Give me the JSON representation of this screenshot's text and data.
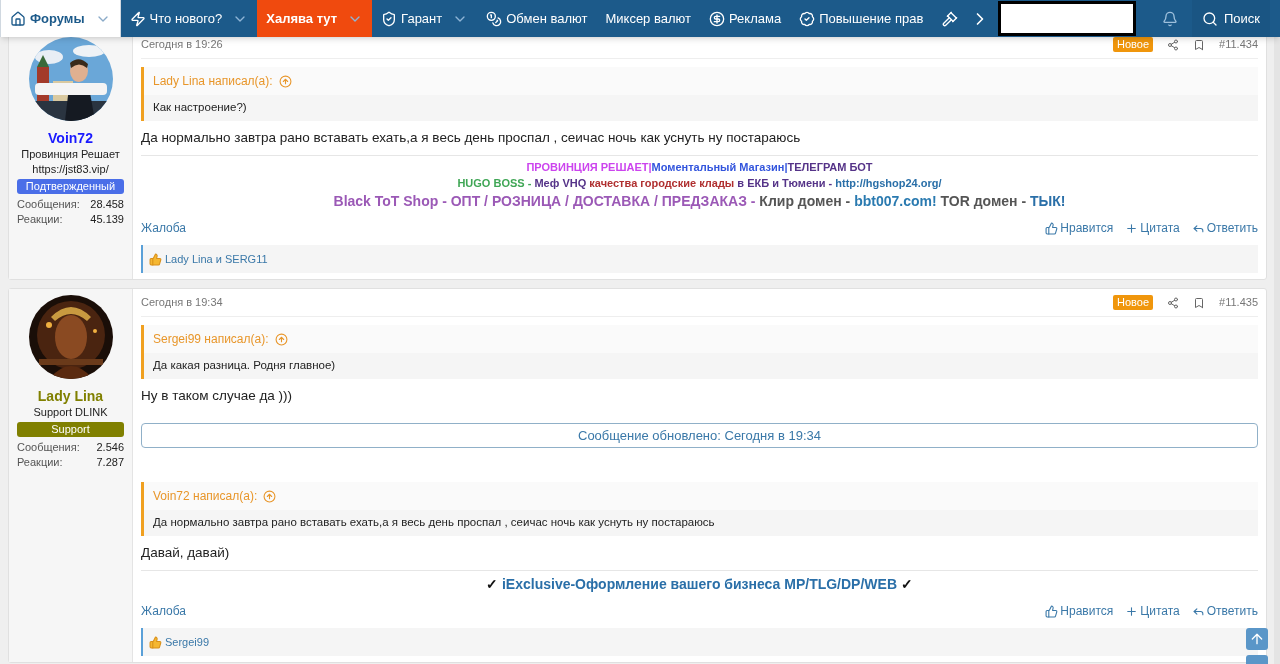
{
  "nav": {
    "items": [
      {
        "label": "Форумы",
        "dropdown": true,
        "selected": true,
        "highlight": false
      },
      {
        "label": "Что нового?",
        "dropdown": true,
        "selected": false,
        "highlight": false
      },
      {
        "label": "Халява тут",
        "dropdown": true,
        "selected": false,
        "highlight": true
      },
      {
        "label": "Гарант",
        "dropdown": true,
        "selected": false,
        "highlight": false
      },
      {
        "label": "Обмен валют",
        "dropdown": false,
        "selected": false,
        "highlight": false
      },
      {
        "label": "Миксер валют",
        "dropdown": false,
        "selected": false,
        "highlight": false
      },
      {
        "label": "Реклама",
        "dropdown": false,
        "selected": false,
        "highlight": false
      },
      {
        "label": "Повышение прав",
        "dropdown": false,
        "selected": false,
        "highlight": false
      }
    ],
    "search": "Поиск"
  },
  "posts": [
    {
      "author": {
        "name": "Voin72",
        "kind": "verified",
        "title": "Провинция Решает",
        "site": "https://jst83.vip/",
        "badge": "Подтвержденный",
        "stats": [
          {
            "label": "Сообщения:",
            "value": "28.458"
          },
          {
            "label": "Реакции:",
            "value": "45.139"
          }
        ]
      },
      "date": "Сегодня в 19:26",
      "new_label": "Новое",
      "is_new": true,
      "number": "#11.434",
      "blocks": [
        {
          "kind": "quote",
          "author": "Lady Lina написал(а):",
          "text": "Как настроение?)"
        },
        {
          "kind": "text",
          "text": "Да нормально завтра рано вставать ехать,а я весь день проспал , сеичас ночь как уснуть ну постараюсь"
        },
        {
          "kind": "signature",
          "lines": [
            {
              "kind": "small",
              "segments": [
                {
                  "text": "ПРОВИНЦИЯ РЕШАЕТ|",
                  "color": "#cc44ee"
                },
                {
                  "text": "Моментальный Магазин|",
                  "color": "#3355dd"
                },
                {
                  "text": "ТЕЛЕГРАМ БОТ",
                  "color": "#553388"
                }
              ]
            },
            {
              "kind": "small",
              "segments": [
                {
                  "text": "HUGO BOSS - ",
                  "color": "#3fa655"
                },
                {
                  "text": "Меф VHQ ",
                  "color": "#553388"
                },
                {
                  "text": "качества городские клады ",
                  "color": "#b03030"
                },
                {
                  "text": "в ЕКБ и Тюмени - ",
                  "color": "#553388"
                },
                {
                  "text": "http://hgshop24.org/",
                  "color": "#2a6fa8"
                }
              ]
            },
            {
              "kind": "large",
              "segments": [
                {
                  "text": "Black ToT Shop - ОПТ / РОЗНИЦА / ДОСТАВКА / ПРЕДЗАКАЗ - ",
                  "color": "#9b59b6"
                },
                {
                  "text": "Клир домен - ",
                  "color": "#555555"
                },
                {
                  "text": "bbt007.com! ",
                  "color": "#2a7ab0"
                },
                {
                  "text": "TOR домен - ",
                  "color": "#555555"
                },
                {
                  "text": "ТЫК!",
                  "color": "#2a6fa8"
                }
              ]
            }
          ]
        }
      ],
      "report": "Жалоба",
      "actions": [
        "Нравится",
        "Цитата",
        "Ответить"
      ],
      "likes": "Lady Lina и SERG11"
    },
    {
      "author": {
        "name": "Lady Lina",
        "kind": "support",
        "title": "Support DLINK",
        "badge": "Support",
        "stats": [
          {
            "label": "Сообщения:",
            "value": "2.546"
          },
          {
            "label": "Реакции:",
            "value": "7.287"
          }
        ]
      },
      "date": "Сегодня в 19:34",
      "new_label": "Новое",
      "is_new": true,
      "number": "#11.435",
      "blocks": [
        {
          "kind": "quote",
          "author": "Sergei99 написал(а):",
          "text": "Да какая разница. Родня главное)"
        },
        {
          "kind": "text",
          "text": "Ну в таком случае да )))"
        },
        {
          "kind": "update",
          "text": "Сообщение обновлено: Сегодня в 19:34"
        },
        {
          "kind": "quote",
          "author": "Voin72 написал(а):",
          "text": "Да нормально завтра рано вставать ехать,а я весь день проспал , сеичас ночь как уснуть ну постараюсь"
        },
        {
          "kind": "text",
          "text": "Давай, давай)"
        },
        {
          "kind": "signature",
          "lines": [
            {
              "kind": "large",
              "segments": [
                {
                  "text": "✓ ",
                  "color": "#111111"
                },
                {
                  "text": "iExclusive-Оформление вашего бизнеса MP/TLG/DP/WEB",
                  "color": "#2a6fa8"
                },
                {
                  "text": " ✓",
                  "color": "#111111"
                }
              ]
            }
          ]
        }
      ],
      "report": "Жалоба",
      "actions": [
        "Нравится",
        "Цитата",
        "Ответить"
      ],
      "likes": "Sergei99"
    }
  ]
}
